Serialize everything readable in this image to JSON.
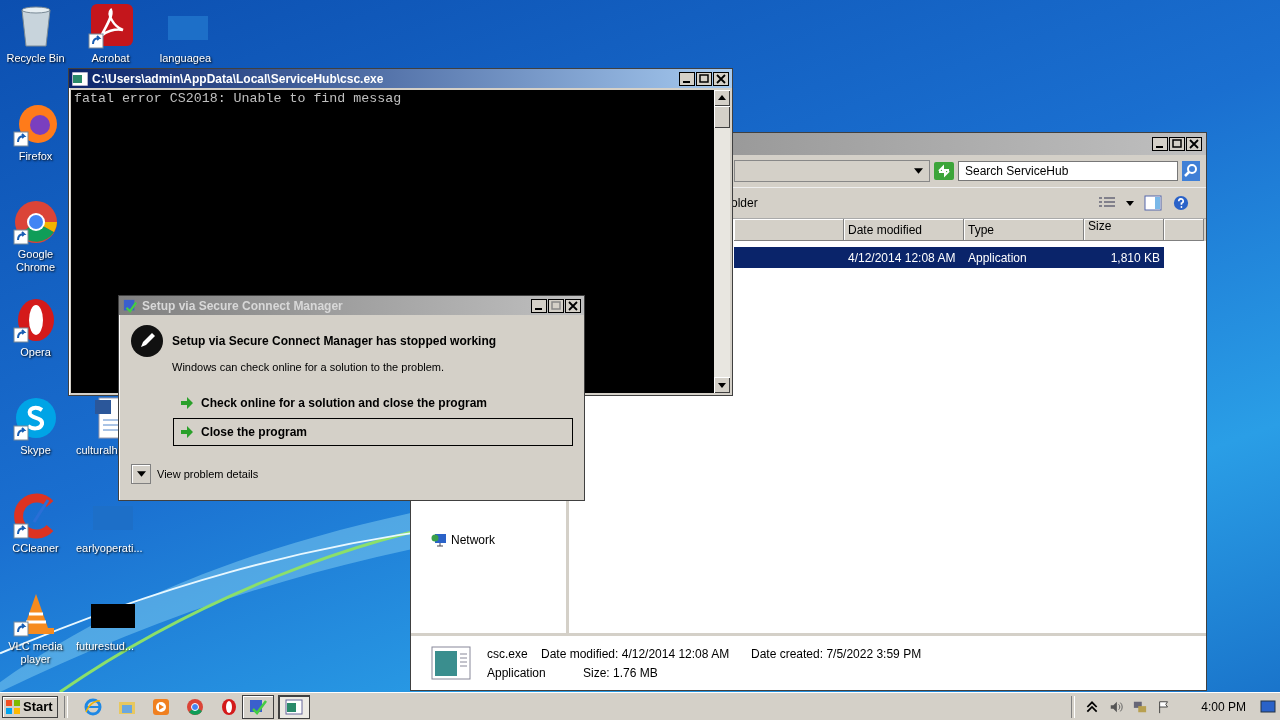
{
  "desktop_icons": [
    {
      "label": "Recycle Bin",
      "kind": "recycle",
      "shortcut": false
    },
    {
      "label": "Acrobat",
      "kind": "acrobat",
      "shortcut": true
    },
    {
      "label": "languagea",
      "kind": "blank",
      "shortcut": false
    },
    {
      "label": "Firefox",
      "kind": "firefox",
      "shortcut": true
    },
    {
      "label": "Google Chrome",
      "kind": "chrome",
      "shortcut": true
    },
    {
      "label": "Opera",
      "kind": "opera",
      "shortcut": true
    },
    {
      "label": "Skype",
      "kind": "skype",
      "shortcut": true
    },
    {
      "label": "culturalh",
      "kind": "word",
      "shortcut": false
    },
    {
      "label": "CCleaner",
      "kind": "ccleaner",
      "shortcut": true
    },
    {
      "label": "earlyoperati...",
      "kind": "blank",
      "shortcut": false
    },
    {
      "label": "VLC media player",
      "kind": "vlc",
      "shortcut": true
    },
    {
      "label": "futurestud...",
      "kind": "dark",
      "shortcut": false
    }
  ],
  "explorer": {
    "search": {
      "placeholder": "Search ServiceHub"
    },
    "toolbar_text": "older",
    "columns": [
      "Date modified",
      "Type",
      "Size"
    ],
    "rows": [
      {
        "date": "4/12/2014 12:08 AM",
        "type": "Application",
        "size": "1,810 KB",
        "selected": true
      }
    ],
    "nav_items": [
      "Network"
    ],
    "details": {
      "name": "csc.exe",
      "type": "Application",
      "modified_label": "Date modified:",
      "modified": "4/12/2014 12:08 AM",
      "size_label": "Size:",
      "size": "1.76 MB",
      "created_label": "Date created:",
      "created": "7/5/2022 3:59 PM"
    }
  },
  "console": {
    "title": "C:\\Users\\admin\\AppData\\Local\\ServiceHub\\csc.exe",
    "lines": [
      "fatal error CS2018: Unable to find messag"
    ]
  },
  "dialog": {
    "title": "Setup via Secure Connect Manager",
    "heading": "Setup via Secure Connect Manager has stopped working",
    "message": "Windows can check online for a solution to the problem.",
    "options": [
      {
        "label": "Check online for a solution and close the program",
        "selected": false
      },
      {
        "label": "Close the program",
        "selected": true
      }
    ],
    "details_toggle": "View problem details"
  },
  "taskbar": {
    "start": "Start",
    "quick_launch": [
      {
        "kind": "ie"
      },
      {
        "kind": "folder"
      },
      {
        "kind": "media"
      },
      {
        "kind": "chrome"
      },
      {
        "kind": "opera"
      }
    ],
    "tasks": [
      {
        "kind": "setup",
        "selected": false
      },
      {
        "kind": "console",
        "selected": true
      }
    ],
    "clock": "4:00 PM"
  }
}
